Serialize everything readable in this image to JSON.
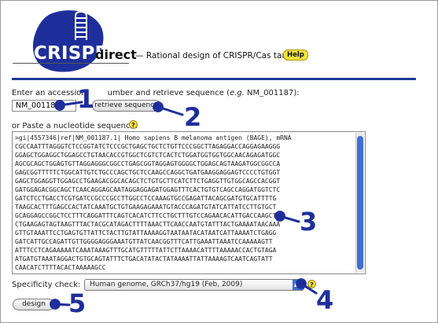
{
  "header": {
    "logo_text": "CRISPR",
    "logo_suffix": "direct",
    "tagline": "— Rational design of CRISPR/Cas target.",
    "help_label": "Help",
    "brand_color": "#1f3b95",
    "logo_color": "#1e2f9c"
  },
  "accession": {
    "label_before": "Enter an accession",
    "label_after": "umber and retrieve sequence (",
    "label_eg": "e.g.",
    "label_example": " NM_001187):",
    "value": "NM_001187",
    "retrieve_label": "retrieve sequence"
  },
  "sequence": {
    "label": "or Paste a nucleotide sequence:",
    "help_icon": "?",
    "text": ">gi|4557346|ref|NM_001187.1| Homo sapiens B melanoma antigen (BAGE), mRNA\nCGCCAATTTAGGGTCTCCGGTATCTCCCGCTGAGCTGCTCTGTTCCCGGCTTAGAGGACCAGGAGAAGGG\nGGAGCTGGAGGCTGGAGCCTGTAACACCGTGGCTCGTCTCACTCTGGATGGTGGTGGCAACAGAGATGGC\nAGCGCAGCTGGAGTGTTAGGAGGGCGGCCTGAGCGGTAGGAGTGGGGCTGGAGCAGTAAGATGGCGGCCA\nGAGCGGTTTTTCTGGCATTGTCTGCCCAGCTGCTCCAAGCCAGGCTGATGAAGGAGGAGTCCCCTGTGGT\nGAGCTGGAGGTTGGAGCCTGAAGACGGCACAGCTCTGTGCTTCATCTTCTGAGGTTGTGGCAGCCACGGT\nGATGGAGACGGCAGCTCAACAGGAGCAATAGGAGGAGATGGAGTTTCACTGTGTCAGCCAGGATGGTCTC\nGATCTCCTGACCTCGTGATCCGCCCGCCTTGGCCTCCAAAGTGCCGAGATTACAGCGATGTGCATTTTG\nTAAGCACTTTGAGCCACTATCAAATGCTGTGAAGAGAAATGTACCCAGATGTATCATTATCCTTGTGCT\nGCAGGAGCCGGCTCCTTTCAGGATTTCAGTCACATCTTCCTGCTTTGTCCAGAACACATTGACCAAGCTC\nCTGAAGAGTAGTAAGTTTACTACGCATAGACTTTTAAACTTCAACCAATGTATTTACTGAAAATAACAAA\nGTTGTAAATTCCTGAGTGTTATTCTACTTGTATTAAAAGGTAATAATACATAATCATTAAAATCTGAGG\nGATCATTGCCAGATTGTTGGGGAGGGAAATGTTATCAACGGTTTCATTGAAATTAAATCCAAAAAGTT\nATTTCCTCAGAAAAATCAAATAAAGTTTGCATGTTTTTATTCTTAAAACATTTTAAAAACCACTGTAGA\nATGATGTAAATAGGACTGTGCAGTATTTCTGACATATACTATAAAATTATTAAAAGTCAATCAGTATT\nCAACATCTTTTACACTAAAAAGCC"
  },
  "specificity": {
    "label": "Specificity check:",
    "selected": "Human genome, GRCh37/hg19 (Feb, 2009)",
    "help_icon": "?"
  },
  "design": {
    "label": "design"
  },
  "annotations": {
    "n1": "1",
    "n2": "2",
    "n3": "3",
    "n4": "4",
    "n5": "5",
    "color": "#1e2f9c"
  }
}
